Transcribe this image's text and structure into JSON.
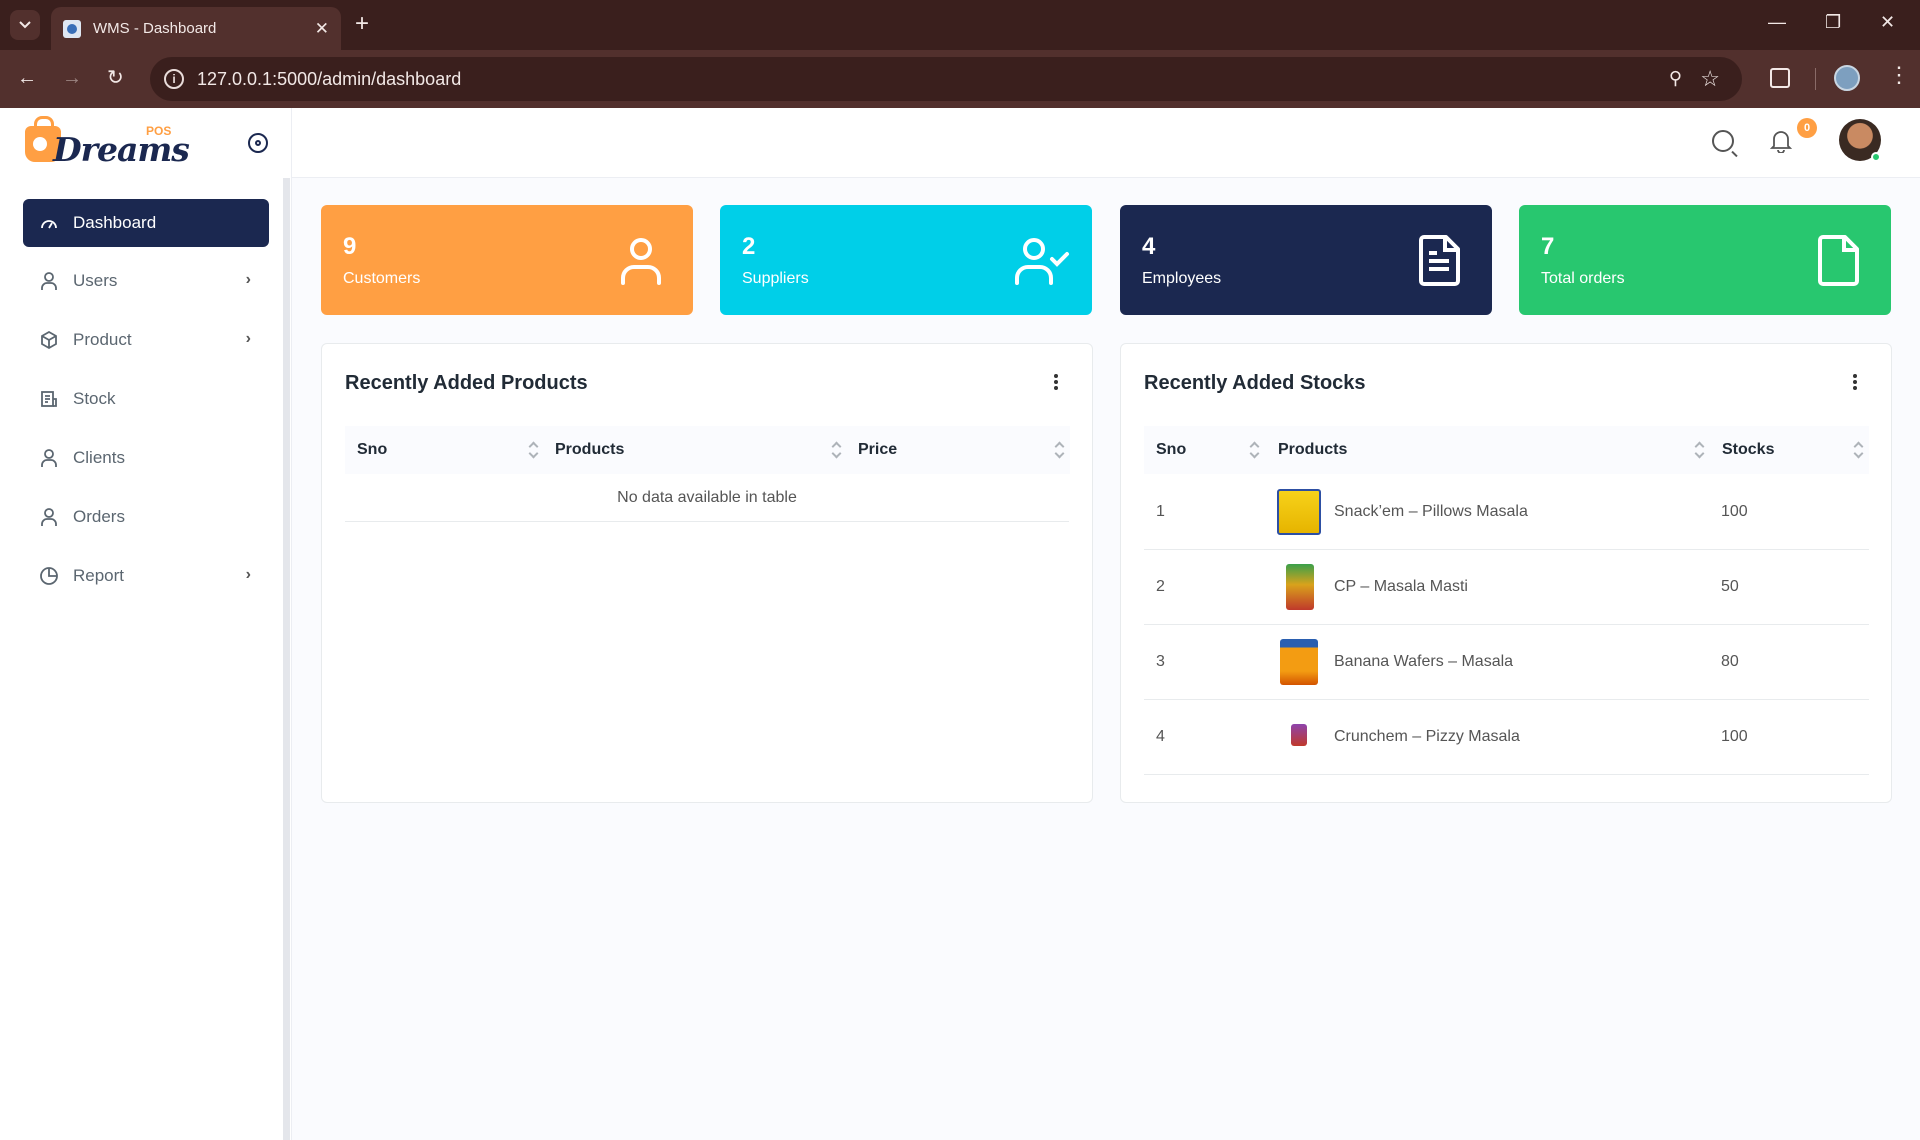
{
  "browser": {
    "tab_title": "WMS - Dashboard",
    "url": "127.0.0.1:5000/admin/dashboard"
  },
  "brand": {
    "name": "Dreams",
    "badge": "POS",
    "accent": "#ff9f43",
    "navy": "#1b2850"
  },
  "sidebar": {
    "items": [
      {
        "label": "Dashboard",
        "icon": "dashboard-icon",
        "active": true
      },
      {
        "label": "Users",
        "icon": "user-icon",
        "has_submenu": true
      },
      {
        "label": "Product",
        "icon": "box-icon",
        "has_submenu": true
      },
      {
        "label": "Stock",
        "icon": "stock-icon"
      },
      {
        "label": "Clients",
        "icon": "user-icon"
      },
      {
        "label": "Orders",
        "icon": "user-icon"
      },
      {
        "label": "Report",
        "icon": "pie-chart-icon",
        "has_submenu": true
      }
    ]
  },
  "header": {
    "notification_count": "0"
  },
  "stats": [
    {
      "value": "9",
      "label": "Customers",
      "color": "#ff9f43",
      "icon": "user-icon"
    },
    {
      "value": "2",
      "label": "Suppliers",
      "color": "#00cfe8",
      "icon": "user-check-icon"
    },
    {
      "value": "4",
      "label": "Employees",
      "color": "#1b2850",
      "icon": "file-text-icon"
    },
    {
      "value": "7",
      "label": "Total orders",
      "color": "#28c76f",
      "icon": "file-icon"
    }
  ],
  "products_panel": {
    "title": "Recently Added Products",
    "columns": [
      "Sno",
      "Products",
      "Price"
    ],
    "empty_message": "No data available in table"
  },
  "stocks_panel": {
    "title": "Recently Added Stocks",
    "columns": [
      "Sno",
      "Products",
      "Stocks"
    ],
    "rows": [
      {
        "sno": "1",
        "product": "Snack’em – Pillows Masala",
        "stock": "100"
      },
      {
        "sno": "2",
        "product": "CP – Masala Masti",
        "stock": "50"
      },
      {
        "sno": "3",
        "product": "Banana Wafers – Masala",
        "stock": "80"
      },
      {
        "sno": "4",
        "product": "Crunchem – Pizzy Masala",
        "stock": "100"
      }
    ]
  }
}
